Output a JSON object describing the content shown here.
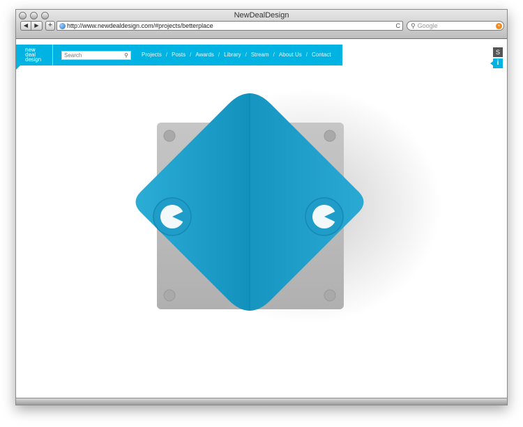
{
  "browser": {
    "window_title": "NewDealDesign",
    "url": "http://www.newdealdesign.com/#projects/betterplace",
    "search_placeholder": "Google",
    "back_label": "◀",
    "forward_label": "▶",
    "add_label": "+",
    "reload_label": "C"
  },
  "site": {
    "logo_lines": [
      "new",
      "deal",
      "design"
    ],
    "search_placeholder": "Search",
    "nav": [
      "Projects",
      "Posts",
      "Awards",
      "Library",
      "Stream",
      "About Us",
      "Contact"
    ],
    "nav_separator": "/",
    "side_s_label": "S",
    "side_info_label": "i"
  },
  "colors": {
    "brand": "#00b3e3",
    "product_blue": "#1a9fc9",
    "concrete": "#bcbcbc"
  },
  "icons": {
    "search": "search-icon",
    "globe": "globe-icon",
    "rss": "rss-icon"
  }
}
